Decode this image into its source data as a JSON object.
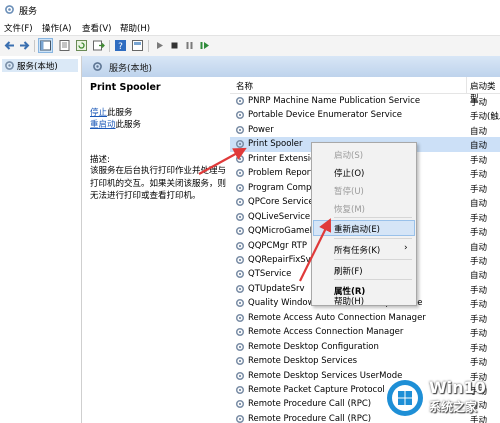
{
  "window": {
    "title": "服务"
  },
  "menubar": {
    "items": [
      "文件(F)",
      "操作(A)",
      "查看(V)",
      "帮助(H)"
    ]
  },
  "toolbar": {
    "icons": [
      "back-icon",
      "forward-icon",
      "console-tree-icon",
      "properties-icon",
      "refresh-icon",
      "export-icon",
      "help-icon",
      "mmc-icon",
      "play-icon",
      "stop-icon",
      "pause-icon",
      "restart-icon"
    ]
  },
  "tree": {
    "root_label": "服务(本地)"
  },
  "panel": {
    "header_label": "服务(本地)"
  },
  "description": {
    "service_name": "Print Spooler",
    "stop_link": "停止",
    "stop_suffix": "此服务",
    "restart_link": "重启动",
    "restart_suffix": "此服务",
    "label": "描述:",
    "lines": [
      "该服务在后台执行打印作业并处理与",
      "打印机的交互。如果关闭该服务，则",
      "无法进行打印或查看打印机。"
    ]
  },
  "list": {
    "columns": {
      "name": "名称",
      "startup": "启动类型"
    },
    "rows": [
      {
        "name": "PNRP Machine Name Publication Service",
        "startup": "手动"
      },
      {
        "name": "Portable Device Enumerator Service",
        "startup": "手动(触发"
      },
      {
        "name": "Power",
        "startup": "自动"
      },
      {
        "name": "Print Spooler",
        "startup": "自动",
        "selected": true
      },
      {
        "name": "Printer Extensions",
        "startup": "手动"
      },
      {
        "name": "Problem Reports Control Panel Support",
        "startup": "手动"
      },
      {
        "name": "Program Compatibility",
        "startup": "手动"
      },
      {
        "name": "QPCore Service",
        "startup": "自动"
      },
      {
        "name": "QQLiveService",
        "startup": "手动"
      },
      {
        "name": "QQMicroGameBox",
        "startup": "手动"
      },
      {
        "name": "QQPCMgr RTP",
        "startup": "自动"
      },
      {
        "name": "QQRepairFixSvc",
        "startup": "手动"
      },
      {
        "name": "QTService",
        "startup": "自动"
      },
      {
        "name": "QTUpdateSrv",
        "startup": "手动"
      },
      {
        "name": "Quality Windows Audio Video Experience",
        "startup": "手动"
      },
      {
        "name": "Remote Access Auto Connection Manager",
        "startup": "手动"
      },
      {
        "name": "Remote Access Connection Manager",
        "startup": "手动"
      },
      {
        "name": "Remote Desktop Configuration",
        "startup": "手动"
      },
      {
        "name": "Remote Desktop Services",
        "startup": "手动"
      },
      {
        "name": "Remote Desktop Services UserMode",
        "startup": "手动"
      },
      {
        "name": "Remote Packet Capture Protocol",
        "startup": "手动"
      },
      {
        "name": "Remote Procedure Call (RPC)",
        "startup": "自动"
      },
      {
        "name": "Remote Procedure Call (RPC)",
        "startup": "手动"
      }
    ]
  },
  "context_menu": {
    "items": [
      {
        "label": "启动(S)",
        "disabled": true
      },
      {
        "label": "停止(O)"
      },
      {
        "label": "暂停(U)",
        "disabled": true
      },
      {
        "label": "恢复(M)",
        "disabled": true
      },
      {
        "label": "重新启动(E)",
        "hover": true
      },
      {
        "label": "所有任务(K)",
        "submenu": true
      },
      {
        "label": "刷新(F)"
      },
      {
        "label": "属性(R)",
        "bold": true
      },
      {
        "label": "帮助(H)"
      }
    ]
  },
  "watermark": {
    "title": "Win10",
    "subtitle": "系统之家"
  },
  "colors": {
    "selection": "#cce0f7",
    "link": "#1b58b8",
    "annotation_arrow": "#e03a3a",
    "menu_hover": "#d5e5f7"
  }
}
